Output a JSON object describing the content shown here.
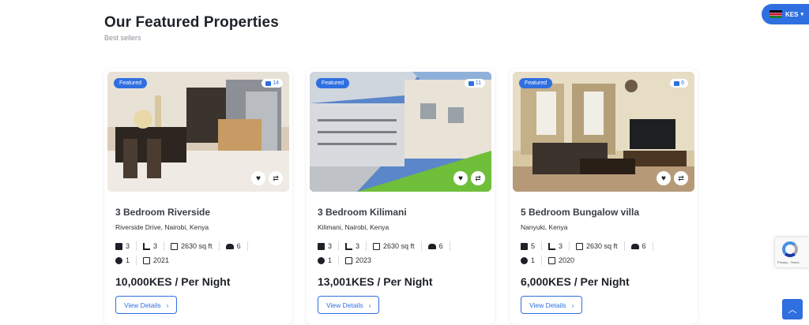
{
  "section": {
    "title": "Our Featured Properties",
    "subtitle": "Best sellers"
  },
  "currency": {
    "code": "KES"
  },
  "cards": [
    {
      "badge": "Featured",
      "photo_count": "14",
      "title": "3 Bedroom Riverside",
      "address": "Riverside Drive, Nairobi, Kenya",
      "bedrooms": "3",
      "bathrooms": "3",
      "area": "2630 sq ft",
      "guests": "6",
      "garages": "1",
      "year": "2021",
      "price": "10,000KES / Per Night",
      "cta": "View Details"
    },
    {
      "badge": "Featured",
      "photo_count": "11",
      "title": "3 Bedroom Kilimani",
      "address": "Kilimani, Nairobi, Kenya",
      "bedrooms": "3",
      "bathrooms": "3",
      "area": "2630 sq ft",
      "guests": "6",
      "garages": "1",
      "year": "2023",
      "price": "13,001KES / Per Night",
      "cta": "View Details"
    },
    {
      "badge": "Featured",
      "photo_count": "6",
      "title": "5 Bedroom Bungalow villa",
      "address": "Nanyuki, Kenya",
      "bedrooms": "5",
      "bathrooms": "3",
      "area": "2630 sq ft",
      "guests": "6",
      "garages": "1",
      "year": "2020",
      "price": "6,000KES / Per Night",
      "cta": "View Details"
    }
  ],
  "recaptcha": {
    "text": "Privacy - Terms"
  },
  "colors": {
    "accent": "#2f6fe0",
    "text": "#1d2127",
    "muted": "#8a8f96"
  },
  "icons": [
    "camera-icon",
    "heart-icon",
    "compare-icon",
    "bed-icon",
    "bath-icon",
    "area-icon",
    "guests-icon",
    "garage-icon",
    "calendar-icon",
    "chevron-right-icon",
    "chevron-up-icon",
    "chevron-down-icon"
  ]
}
